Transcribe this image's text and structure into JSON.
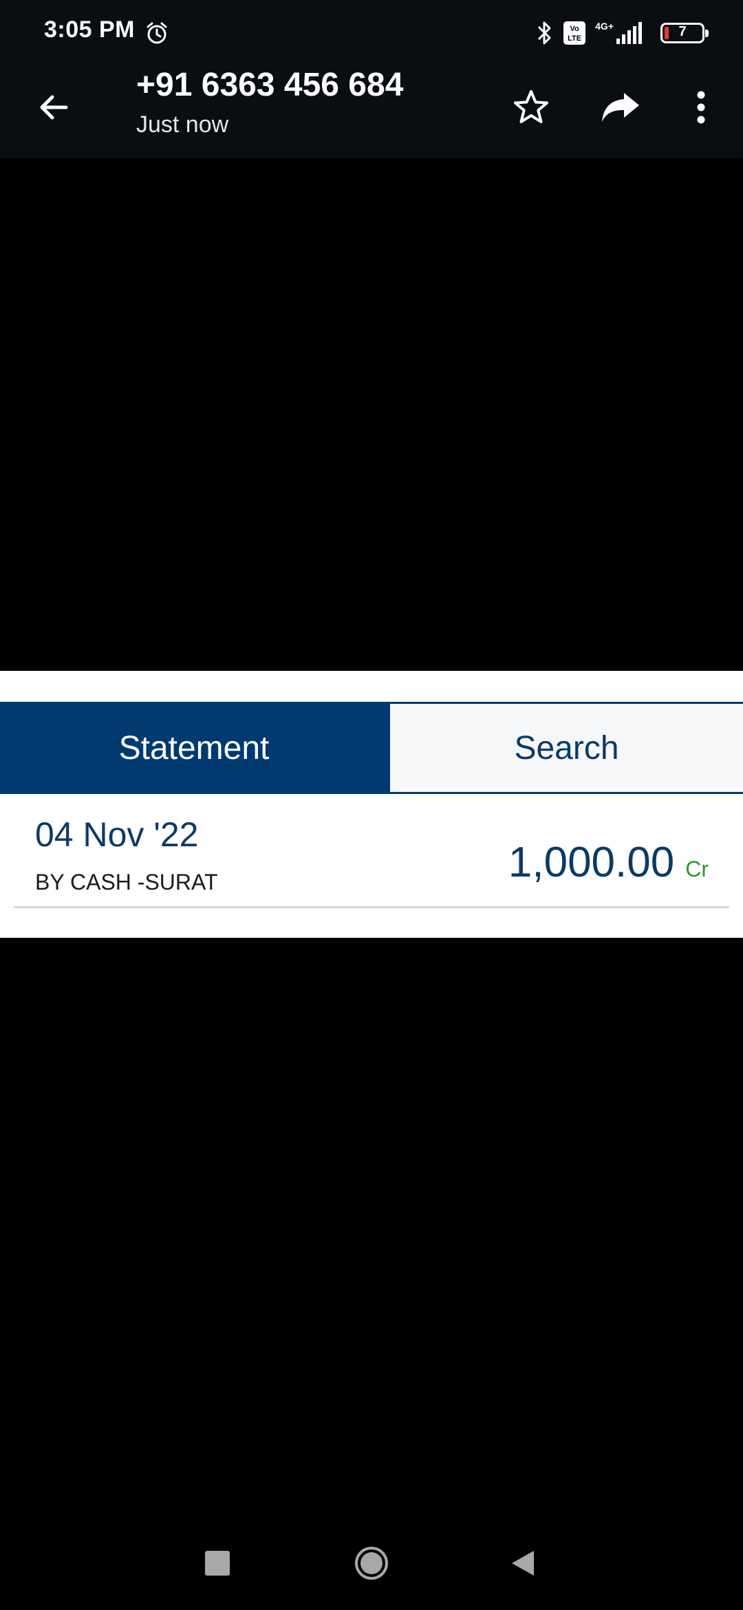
{
  "status_bar": {
    "time": "3:05 PM",
    "network_type": "4G+",
    "volte_label": "Vo LTE",
    "battery_level": "7"
  },
  "header": {
    "title": "+91 6363 456 684",
    "subtitle": "Just now"
  },
  "image_content": {
    "tabs": [
      {
        "label": "Statement",
        "active": true
      },
      {
        "label": "Search",
        "active": false
      }
    ],
    "transaction": {
      "date": "04 Nov '22",
      "description": "BY CASH -SURAT",
      "amount": "1,000.00",
      "type": "Cr"
    }
  },
  "colors": {
    "header_bg": "#0a0e13",
    "tab_active_bg": "#003a70",
    "text_primary_blue": "#0b3a66",
    "credit_green": "#2e9b2e",
    "battery_low": "#e53935"
  },
  "icons": {
    "alarm": "alarm-icon",
    "bluetooth": "bluetooth-icon",
    "signal": "signal-icon",
    "battery": "battery-icon",
    "back": "arrow-left-icon",
    "star": "star-icon",
    "share": "share-icon",
    "more": "more-vertical-icon",
    "nav_recents": "square-icon",
    "nav_home": "circle-icon",
    "nav_back": "triangle-back-icon"
  }
}
